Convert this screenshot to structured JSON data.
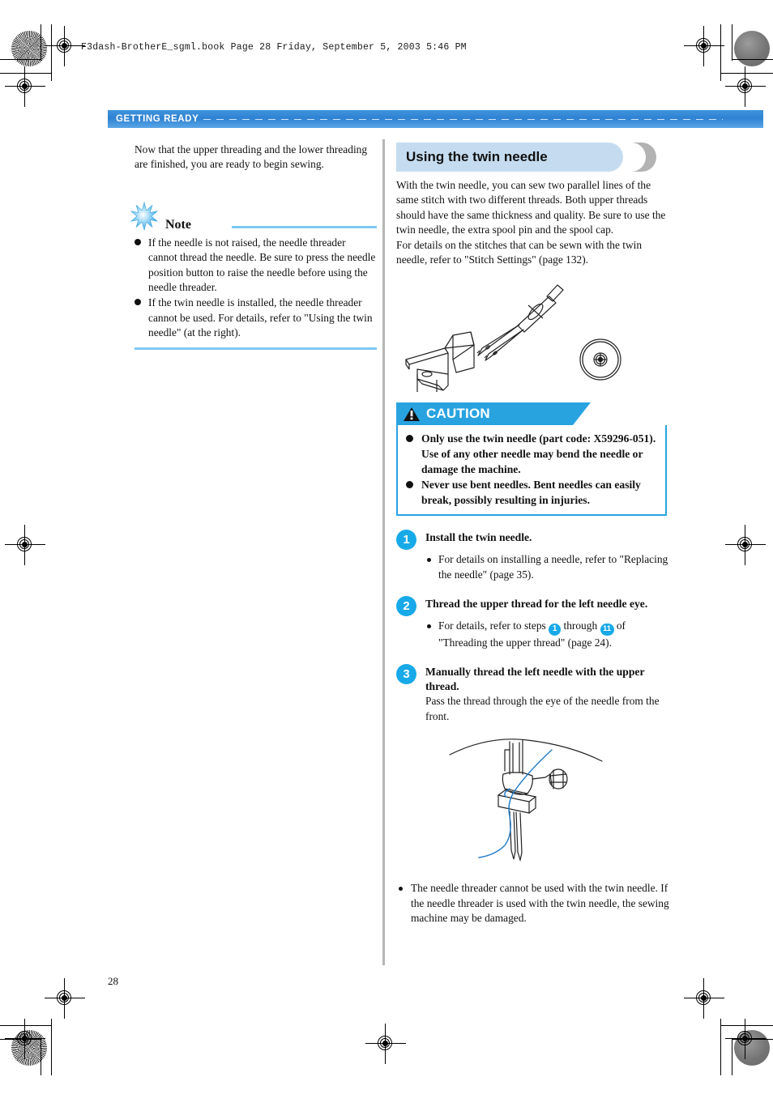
{
  "document_header": "F3dash-BrotherE_sgml.book  Page 28  Friday, September 5, 2003  5:46 PM",
  "running_header": {
    "label": "GETTING READY"
  },
  "page_number": "28",
  "left_column": {
    "intro": "Now that the upper threading and the lower threading are finished, you are ready to begin sewing.",
    "note": {
      "title": "Note",
      "icon": "starburst-icon",
      "items": [
        "If the needle is not raised, the needle threader cannot thread the needle. Be sure to press the needle position button to raise the needle before using the needle threader.",
        "If the twin needle is installed, the needle threader cannot be used. For details, refer to \"Using the twin needle\" (at the right)."
      ]
    }
  },
  "right_column": {
    "section_title": "Using the twin needle",
    "intro_1": "With the twin needle, you can sew two parallel lines of the same stitch with two different threads. Both upper threads should have the same thickness and quality. Be sure to use the twin needle, the extra spool pin and the spool cap.",
    "intro_2": "For details on the stitches that can be sewn with the twin needle, refer to \"Stitch Settings\" (page 132).",
    "illustration_1": "twin-needle-spool-pin-spool-cap-illustration",
    "caution": {
      "label": "CAUTION",
      "icon": "warning-triangle-icon",
      "items": [
        "Only use the twin needle (part code: X59296-051). Use of any other needle may bend the needle or damage the machine.",
        "Never use bent needles. Bent needles can easily break, possibly resulting in injuries."
      ]
    },
    "steps": [
      {
        "number": "1",
        "title": "Install the twin needle.",
        "bullets": [
          "For details on installing a needle, refer to \"Replacing the needle\" (page 35)."
        ]
      },
      {
        "number": "2",
        "title": "Thread the upper thread for the left needle eye.",
        "bullet_prefix": "For details, refer to steps",
        "bullet_ref_1": "1",
        "bullet_mid": "through",
        "bullet_ref_2": "11",
        "bullet_suffix": "of \"Threading the upper thread\" (page 24)."
      },
      {
        "number": "3",
        "title": "Manually thread the left needle with the upper thread.",
        "body": "Pass the thread through the eye of the needle from the front."
      }
    ],
    "illustration_2": "needle-bar-twin-needle-threading-illustration",
    "closing_note": "The needle threader cannot be used with the twin needle. If the needle threader is used with the twin needle, the sewing machine may be damaged."
  },
  "colors": {
    "header_bar_blue": "#2f82d2",
    "accent_blue": "#29a3e0",
    "step_badge_blue": "#17a9e8",
    "section_pill_blue": "#c5dcf0",
    "rule_blue": "#7ec8f2",
    "thread_blue": "#2277cc"
  }
}
